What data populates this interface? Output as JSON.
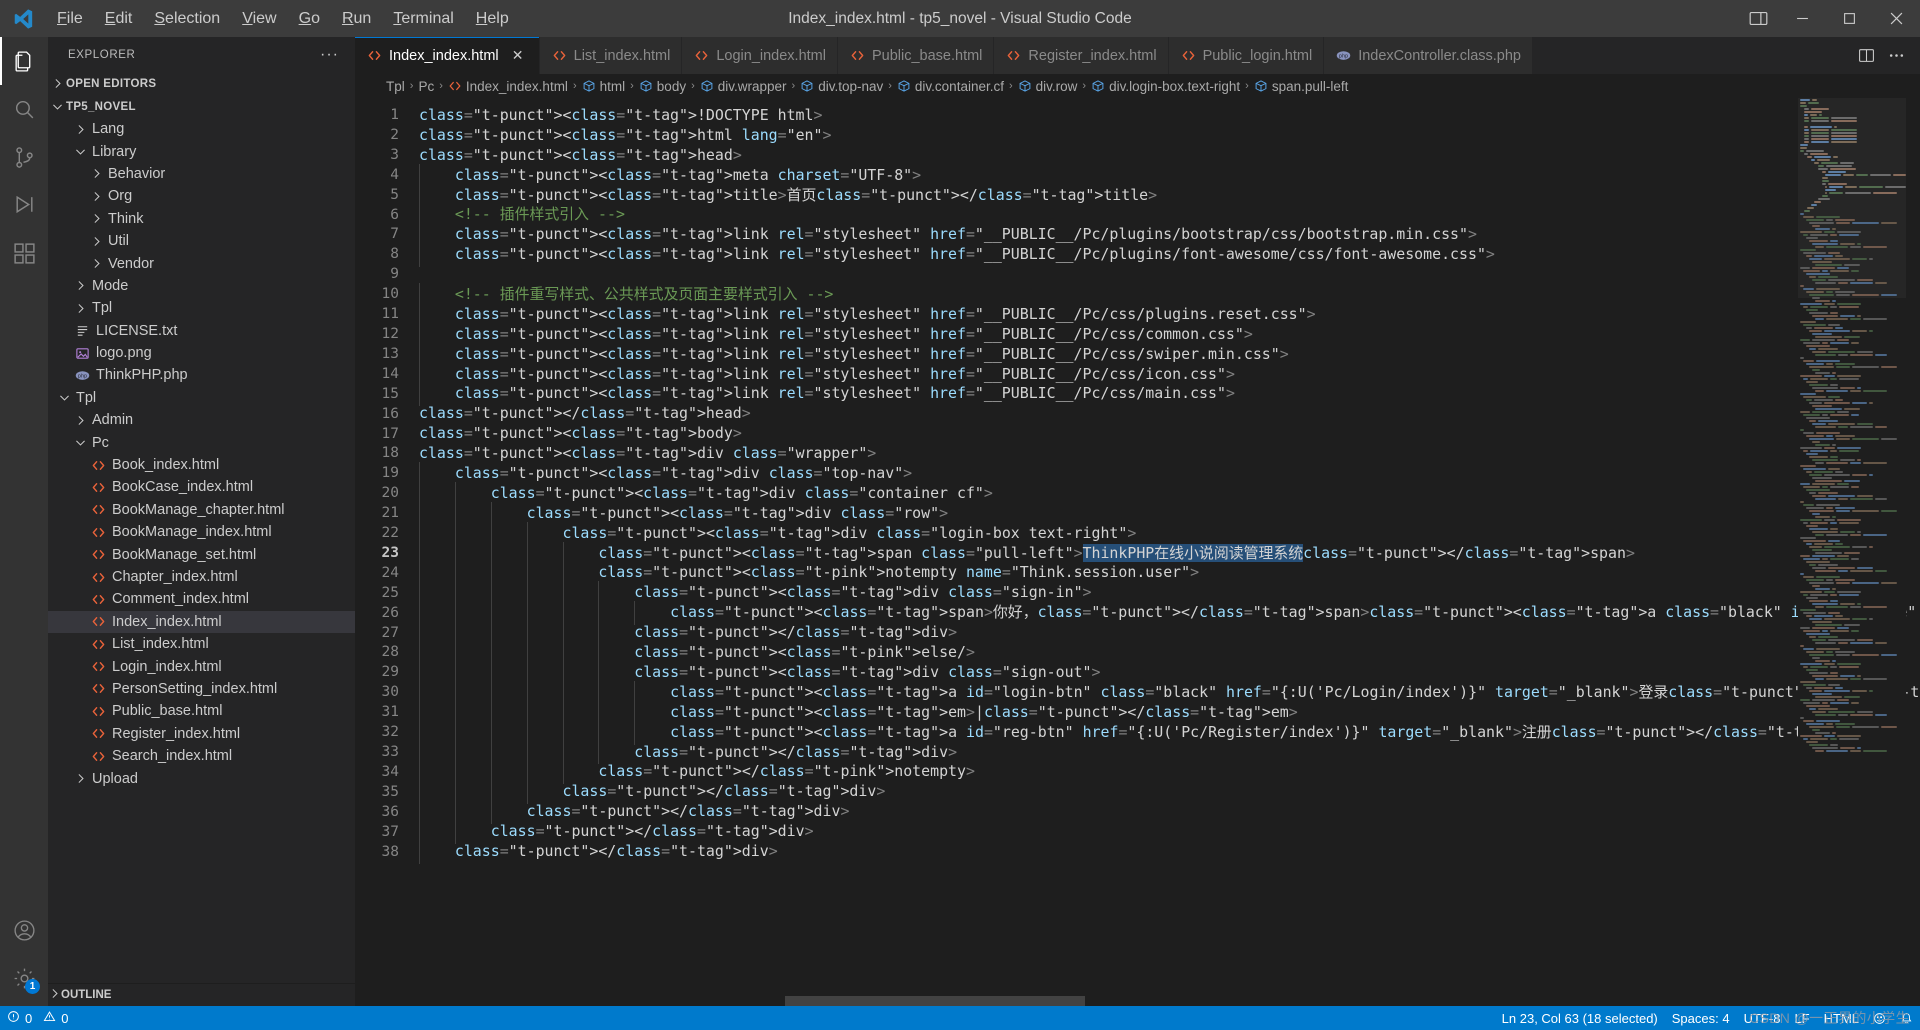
{
  "window": {
    "title": "Index_index.html - tp5_novel - Visual Studio Code",
    "menu": [
      "File",
      "Edit",
      "Selection",
      "View",
      "Go",
      "Run",
      "Terminal",
      "Help"
    ],
    "controls": {
      "layout": "layout-icon",
      "minimize": "minimize-icon",
      "maximize": "maximize-icon",
      "close": "close-icon"
    }
  },
  "activitybar": {
    "items": [
      {
        "name": "explorer",
        "icon": "files-icon",
        "active": true
      },
      {
        "name": "search",
        "icon": "search-icon",
        "active": false
      },
      {
        "name": "source-control",
        "icon": "source-control-icon",
        "active": false
      },
      {
        "name": "run-and-debug",
        "icon": "run-debug-icon",
        "active": false
      },
      {
        "name": "extensions",
        "icon": "extensions-icon",
        "active": false
      }
    ],
    "bottom": [
      {
        "name": "accounts",
        "icon": "account-icon",
        "badge": ""
      },
      {
        "name": "manage",
        "icon": "gear-icon",
        "badge": "1"
      }
    ]
  },
  "sidebar": {
    "title": "EXPLORER",
    "more_label": "···",
    "sections": [
      {
        "label": "OPEN EDITORS",
        "expanded": false
      },
      {
        "label": "TP5_NOVEL",
        "expanded": true
      }
    ],
    "outline_label": "OUTLINE",
    "tree": [
      {
        "label": "Lang",
        "type": "folder",
        "depth": 1,
        "expanded": false
      },
      {
        "label": "Library",
        "type": "folder",
        "depth": 1,
        "expanded": true
      },
      {
        "label": "Behavior",
        "type": "folder",
        "depth": 2,
        "expanded": false
      },
      {
        "label": "Org",
        "type": "folder",
        "depth": 2,
        "expanded": false
      },
      {
        "label": "Think",
        "type": "folder",
        "depth": 2,
        "expanded": false
      },
      {
        "label": "Util",
        "type": "folder",
        "depth": 2,
        "expanded": false
      },
      {
        "label": "Vendor",
        "type": "folder",
        "depth": 2,
        "expanded": false
      },
      {
        "label": "Mode",
        "type": "folder",
        "depth": 1,
        "expanded": false
      },
      {
        "label": "Tpl",
        "type": "folder",
        "depth": 1,
        "expanded": false
      },
      {
        "label": "LICENSE.txt",
        "type": "txt",
        "depth": 1
      },
      {
        "label": "logo.png",
        "type": "png",
        "depth": 1
      },
      {
        "label": "ThinkPHP.php",
        "type": "php",
        "depth": 1
      },
      {
        "label": "Tpl",
        "type": "folder",
        "depth": 0,
        "expanded": true
      },
      {
        "label": "Admin",
        "type": "folder",
        "depth": 1,
        "expanded": false
      },
      {
        "label": "Pc",
        "type": "folder",
        "depth": 1,
        "expanded": true
      },
      {
        "label": "Book_index.html",
        "type": "html",
        "depth": 2
      },
      {
        "label": "BookCase_index.html",
        "type": "html",
        "depth": 2
      },
      {
        "label": "BookManage_chapter.html",
        "type": "html",
        "depth": 2
      },
      {
        "label": "BookManage_index.html",
        "type": "html",
        "depth": 2
      },
      {
        "label": "BookManage_set.html",
        "type": "html",
        "depth": 2
      },
      {
        "label": "Chapter_index.html",
        "type": "html",
        "depth": 2
      },
      {
        "label": "Comment_index.html",
        "type": "html",
        "depth": 2
      },
      {
        "label": "Index_index.html",
        "type": "html",
        "depth": 2,
        "selected": true
      },
      {
        "label": "List_index.html",
        "type": "html",
        "depth": 2
      },
      {
        "label": "Login_index.html",
        "type": "html",
        "depth": 2
      },
      {
        "label": "PersonSetting_index.html",
        "type": "html",
        "depth": 2
      },
      {
        "label": "Public_base.html",
        "type": "html",
        "depth": 2
      },
      {
        "label": "Register_index.html",
        "type": "html",
        "depth": 2
      },
      {
        "label": "Search_index.html",
        "type": "html",
        "depth": 2
      },
      {
        "label": "Upload",
        "type": "folder",
        "depth": 1,
        "expanded": false
      }
    ]
  },
  "editor": {
    "tabs": [
      {
        "label": "Index_index.html",
        "icon": "html-icon",
        "active": true,
        "close": "×"
      },
      {
        "label": "List_index.html",
        "icon": "html-icon",
        "active": false
      },
      {
        "label": "Login_index.html",
        "icon": "html-icon",
        "active": false
      },
      {
        "label": "Public_base.html",
        "icon": "html-icon",
        "active": false
      },
      {
        "label": "Register_index.html",
        "icon": "html-icon",
        "active": false
      },
      {
        "label": "Public_login.html",
        "icon": "html-icon",
        "active": false
      },
      {
        "label": "IndexController.class.php",
        "icon": "php-icon",
        "active": false
      }
    ],
    "tab_actions": [
      {
        "name": "split-editor",
        "icon": "split-editor-icon"
      },
      {
        "name": "more-actions",
        "icon": "ellipsis-icon"
      }
    ],
    "breadcrumbs": [
      {
        "label": "Tpl",
        "icon": ""
      },
      {
        "label": "Pc",
        "icon": ""
      },
      {
        "label": "Index_index.html",
        "icon": "html-icon"
      },
      {
        "label": "html",
        "icon": "symbol-icon"
      },
      {
        "label": "body",
        "icon": "symbol-icon"
      },
      {
        "label": "div.wrapper",
        "icon": "symbol-icon"
      },
      {
        "label": "div.top-nav",
        "icon": "symbol-icon"
      },
      {
        "label": "div.container.cf",
        "icon": "symbol-icon"
      },
      {
        "label": "div.row",
        "icon": "symbol-icon"
      },
      {
        "label": "div.login-box.text-right",
        "icon": "symbol-icon"
      },
      {
        "label": "span.pull-left",
        "icon": "symbol-icon"
      }
    ],
    "separator": "›",
    "first_line": 1,
    "last_line": 38,
    "current_line": 23,
    "lines": [
      "<!DOCTYPE html>",
      "<html lang=\"en\">",
      "<head>",
      "    <meta charset=\"UTF-8\">",
      "    <title>首页</title>",
      "    <!-- 插件样式引入 -->",
      "    <link rel=\"stylesheet\" href=\"__PUBLIC__/Pc/plugins/bootstrap/css/bootstrap.min.css\">",
      "    <link rel=\"stylesheet\" href=\"__PUBLIC__/Pc/plugins/font-awesome/css/font-awesome.css\">",
      "",
      "    <!-- 插件重写样式、公共样式及页面主要样式引入 -->",
      "    <link rel=\"stylesheet\" href=\"__PUBLIC__/Pc/css/plugins.reset.css\">",
      "    <link rel=\"stylesheet\" href=\"__PUBLIC__/Pc/css/common.css\">",
      "    <link rel=\"stylesheet\" href=\"__PUBLIC__/Pc/css/swiper.min.css\">",
      "    <link rel=\"stylesheet\" href=\"__PUBLIC__/Pc/css/icon.css\">",
      "    <link rel=\"stylesheet\" href=\"__PUBLIC__/Pc/css/main.css\">",
      "</head>",
      "<body>",
      "<div class=\"wrapper\">",
      "    <div class=\"top-nav\">",
      "        <div class=\"container cf\">",
      "            <div class=\"row\">",
      "                <div class=\"login-box text-right\">",
      "                    <span class=\"pull-left\">ThinkPHP在线小说阅读管理系统</span>",
      "                    <notempty name=\"Think.session.user\">",
      "                        <div class=\"sign-in\">",
      "                            <span>你好，</span><a class=\"black\" id=\"user-name\" href=\"{:U('Pc/PersonSetting/index')}\" target=\"_blank'",
      "                        </div>",
      "                        <else/>",
      "                        <div class=\"sign-out\">",
      "                            <a id=\"login-btn\" class=\"black\" href=\"{:U('Pc/Login/index')}\" target=\"_blank\">登录</a>",
      "                            <em>|</em>",
      "                            <a id=\"reg-btn\" href=\"{:U('Pc/Register/index')}\" target=\"_blank\">注册</a>",
      "                        </div>",
      "                    </notempty>",
      "                </div>",
      "            </div>",
      "        </div>",
      "    </div>"
    ],
    "selected_text": "ThinkPHP在线小说阅读管理系统"
  },
  "statusbar": {
    "left": [
      {
        "name": "remote-indicator",
        "label": "",
        "icon": "remote-icon"
      },
      {
        "name": "problems",
        "label": "0  0",
        "errors": "0",
        "warnings": "0"
      }
    ],
    "errors": "0",
    "warnings": "0",
    "right": [
      {
        "name": "editor-position",
        "label": "Ln 23, Col 63 (18 selected)"
      },
      {
        "name": "editor-indentation",
        "label": "Spaces: 4"
      },
      {
        "name": "editor-encoding",
        "label": "UTF-8"
      },
      {
        "name": "editor-eol",
        "label": "LF"
      },
      {
        "name": "editor-language",
        "label": "HTML"
      },
      {
        "name": "editor-feedback",
        "label": "☺"
      },
      {
        "name": "notifications",
        "label": "🔔"
      }
    ]
  },
  "watermark": "CSDN @一正界的小学生",
  "colors": {
    "accent": "#007acc",
    "titlebar": "#3c3c3c",
    "sidebar": "#252526",
    "editor": "#1e1e1e",
    "activitybar": "#333333",
    "selection": "#264f78",
    "tab_active_border": "#0078d4"
  }
}
